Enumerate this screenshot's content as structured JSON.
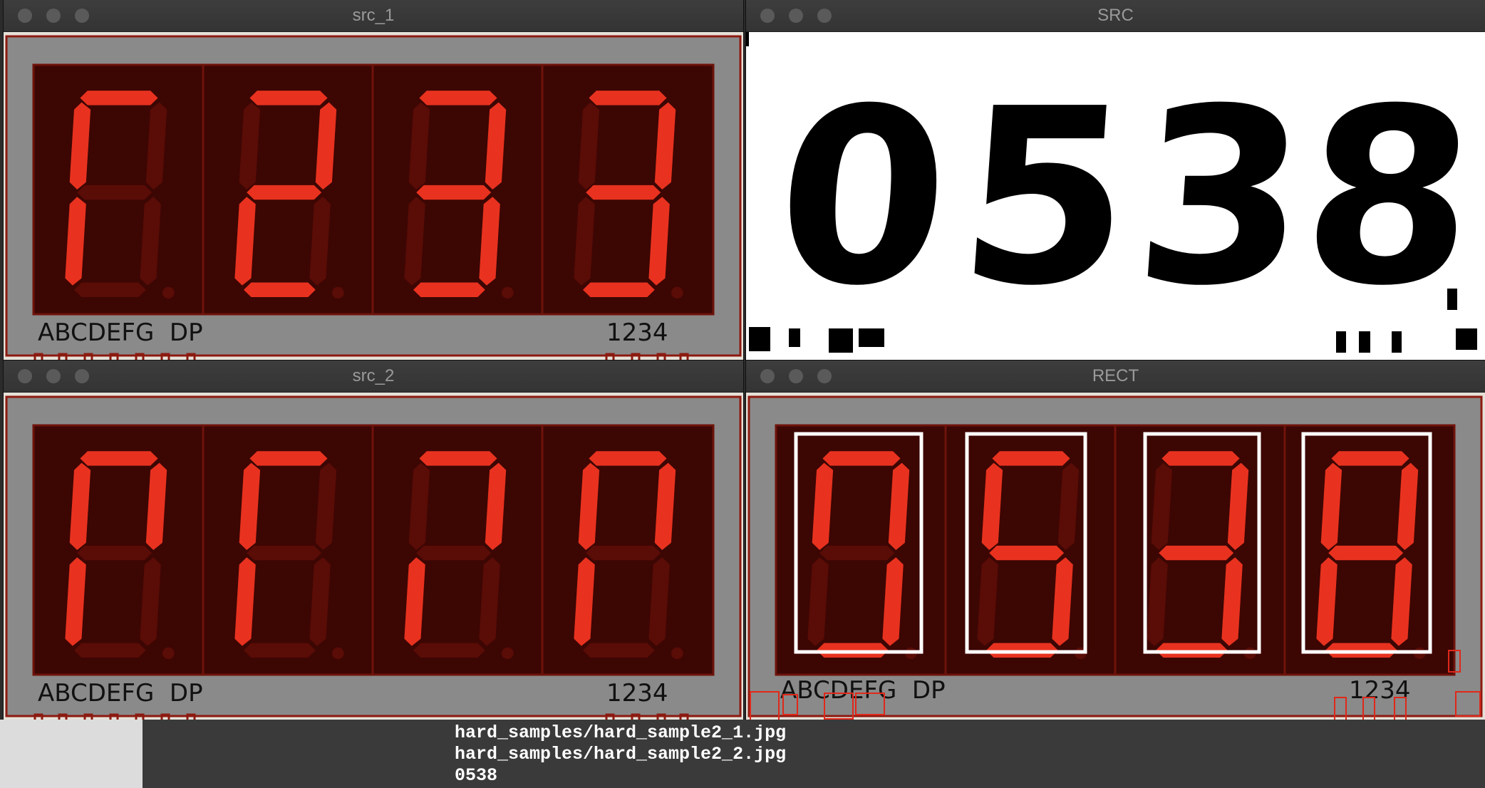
{
  "windows": {
    "src1": {
      "title": "src_1",
      "segment_label": "ABCDEFG  DP",
      "digit_label": "1234"
    },
    "src": {
      "title": "SRC",
      "recognized_digits": [
        "0",
        "5",
        "3",
        "8"
      ]
    },
    "src2": {
      "title": "src_2",
      "segment_label": "ABCDEFG  DP",
      "digit_label": "1234"
    },
    "rect": {
      "title": "RECT",
      "segment_label": "ABCDEFG  DP",
      "digit_label": "1234"
    }
  },
  "terminal": {
    "lines": [
      "hard_samples/hard_sample2_1.jpg",
      "hard_samples/hard_sample2_2.jpg",
      "0538"
    ]
  },
  "colors": {
    "segment_on": "#e8321f",
    "segment_off": "#5a0c06",
    "digit_bg": "#3c0603",
    "panel_grey": "#8a8a8a",
    "panel_border": "#8c1a10",
    "detection_box": "#ffffff",
    "noise_box": "#e0281a"
  },
  "displays": {
    "src1": [
      [
        "a",
        "e",
        "f"
      ],
      [
        "a",
        "b",
        "d",
        "e",
        "g"
      ],
      [
        "a",
        "b",
        "c",
        "d",
        "g"
      ],
      [
        "a",
        "b",
        "c",
        "d",
        "g"
      ]
    ],
    "src2": [
      [
        "a",
        "e",
        "f",
        "b"
      ],
      [
        "a",
        "e",
        "f"
      ],
      [
        "a",
        "b",
        "e"
      ],
      [
        "a",
        "b",
        "e",
        "f"
      ]
    ],
    "rect": [
      [
        "a",
        "b",
        "c",
        "d",
        "f"
      ],
      [
        "a",
        "c",
        "d",
        "f",
        "g"
      ],
      [
        "a",
        "b",
        "c",
        "d",
        "g"
      ],
      [
        "a",
        "b",
        "c",
        "d",
        "e",
        "f",
        "g"
      ]
    ]
  }
}
